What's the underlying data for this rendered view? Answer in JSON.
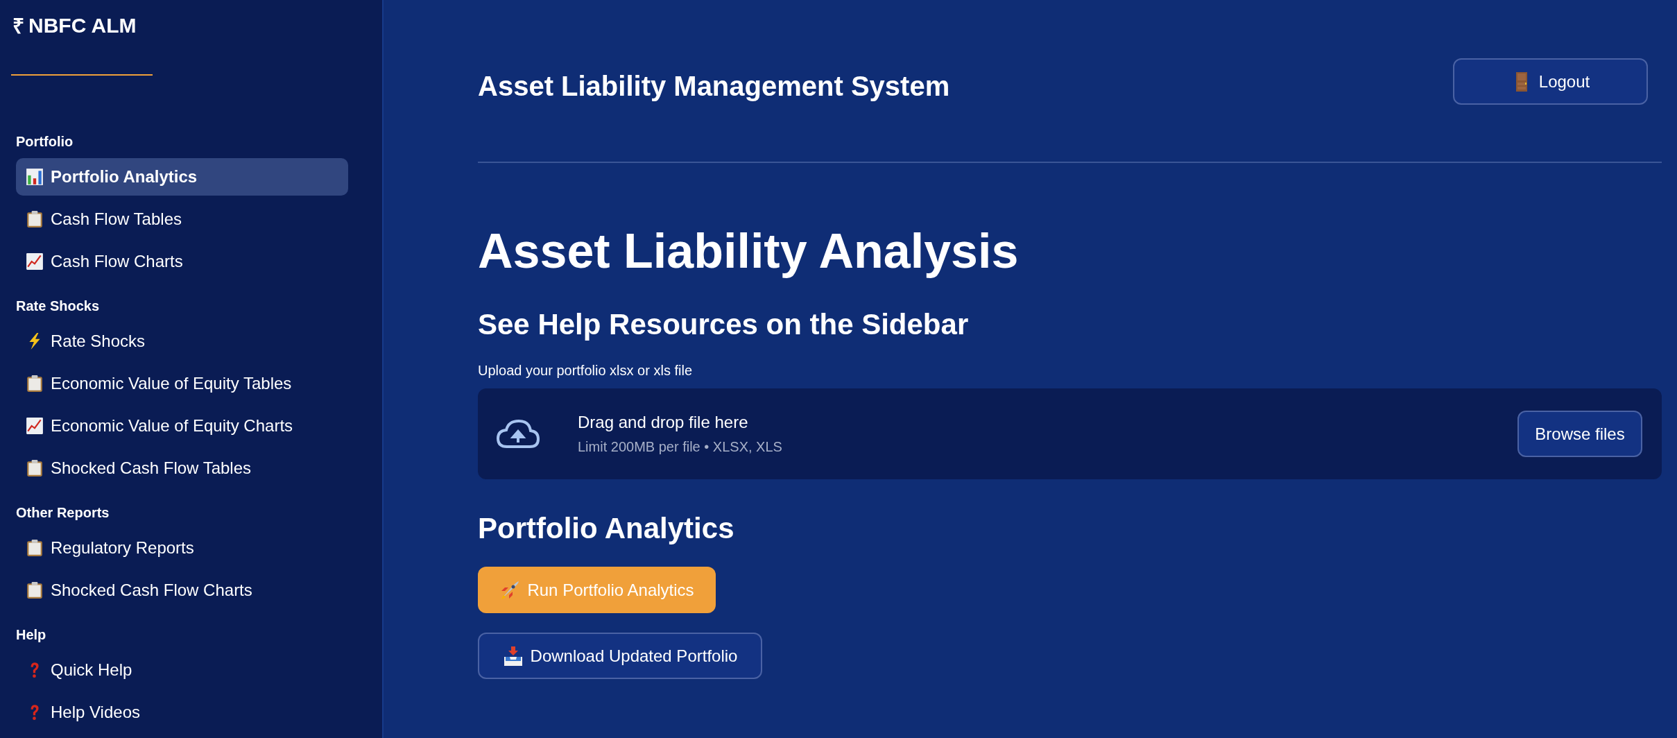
{
  "sidebar": {
    "logo": {
      "symbol": "₹",
      "text": "NBFC ALM"
    },
    "sections": [
      {
        "title": "Portfolio",
        "items": [
          {
            "label": "Portfolio Analytics",
            "kind": "barchart",
            "selected": true
          },
          {
            "label": "Cash Flow Tables",
            "kind": "clipboard",
            "selected": false
          },
          {
            "label": "Cash Flow Charts",
            "kind": "trend",
            "selected": false
          }
        ]
      },
      {
        "title": "Rate Shocks",
        "items": [
          {
            "label": "Rate Shocks",
            "kind": "bolt",
            "selected": false
          },
          {
            "label": "Economic Value of Equity Tables",
            "kind": "clipboard",
            "selected": false
          },
          {
            "label": "Economic Value of Equity Charts",
            "kind": "trend",
            "selected": false
          },
          {
            "label": "Shocked Cash Flow Tables",
            "kind": "clipboard",
            "selected": false
          }
        ]
      },
      {
        "title": "Other Reports",
        "items": [
          {
            "label": "Regulatory Reports",
            "kind": "clipboard",
            "selected": false
          },
          {
            "label": "Shocked Cash Flow Charts",
            "kind": "clipboard",
            "selected": false
          }
        ]
      },
      {
        "title": "Help",
        "items": [
          {
            "label": "Quick Help",
            "kind": "question",
            "selected": false
          },
          {
            "label": "Help Videos",
            "kind": "question",
            "selected": false
          }
        ]
      }
    ]
  },
  "header": {
    "title": "Asset Liability Management System",
    "logout_button": "Logout"
  },
  "main": {
    "title": "Asset Liability Analysis",
    "subtitle": "See Help Resources on the Sidebar",
    "uploader": {
      "label": "Upload your portfolio xlsx or xls file",
      "drop_text": "Drag and drop file here",
      "limit_text": "Limit 200MB per file • XLSX, XLS",
      "browse_button": "Browse files"
    },
    "section_title": "Portfolio Analytics",
    "run_button": "Run Portfolio Analytics",
    "download_button": "Download Updated Portfolio"
  }
}
